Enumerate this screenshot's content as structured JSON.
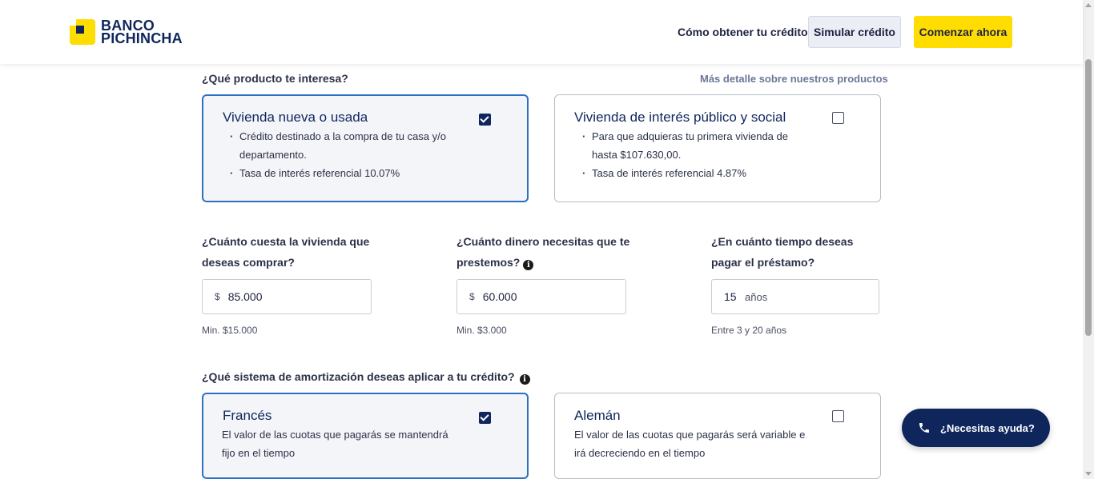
{
  "header": {
    "logo_line1": "BANCO",
    "logo_line2": "PICHINCHA",
    "nav_link": "Cómo obtener tu crédito",
    "simulate_button": "Simular crédito",
    "start_button": "Comenzar ahora"
  },
  "product": {
    "question": "¿Qué producto te interesa?",
    "more_link": "Más detalle sobre nuestros productos",
    "options": [
      {
        "title": "Vivienda nueva o usada",
        "bullets": [
          "Crédito destinado a la compra de tu casa y/o departamento.",
          "Tasa de interés referencial 10.07%"
        ],
        "selected": true
      },
      {
        "title": "Vivienda de interés público y social",
        "bullets": [
          "Para que adquieras tu primera vivienda de hasta $107.630,00.",
          "Tasa de interés referencial 4.87%"
        ],
        "selected": false
      }
    ]
  },
  "fields": {
    "price": {
      "label": "¿Cuánto cuesta la vivienda que deseas comprar?",
      "prefix": "$",
      "value": "85.000",
      "hint": "Min. $15.000"
    },
    "loan": {
      "label": "¿Cuánto dinero necesitas que te prestemos?",
      "prefix": "$",
      "value": "60.000",
      "hint": "Min. $3.000"
    },
    "term": {
      "label": "¿En cuánto tiempo deseas pagar el préstamo?",
      "value": "15",
      "suffix": "años",
      "hint": "Entre 3 y 20 años"
    }
  },
  "amortization": {
    "question": "¿Qué sistema de amortización deseas aplicar a tu crédito?",
    "options": [
      {
        "title": "Francés",
        "desc": "El valor de las cuotas que pagarás se mantendrá fijo en el tiempo",
        "selected": true
      },
      {
        "title": "Alemán",
        "desc": "El valor de las cuotas que pagarás será variable e irá decreciendo en el tiempo",
        "selected": false
      }
    ]
  },
  "help": {
    "label": "¿Necesitas ayuda?"
  },
  "info_glyph": "i",
  "colors": {
    "brand_yellow": "#ffdd00",
    "brand_navy": "#0f265c",
    "selected_border": "#2d6fc0"
  }
}
